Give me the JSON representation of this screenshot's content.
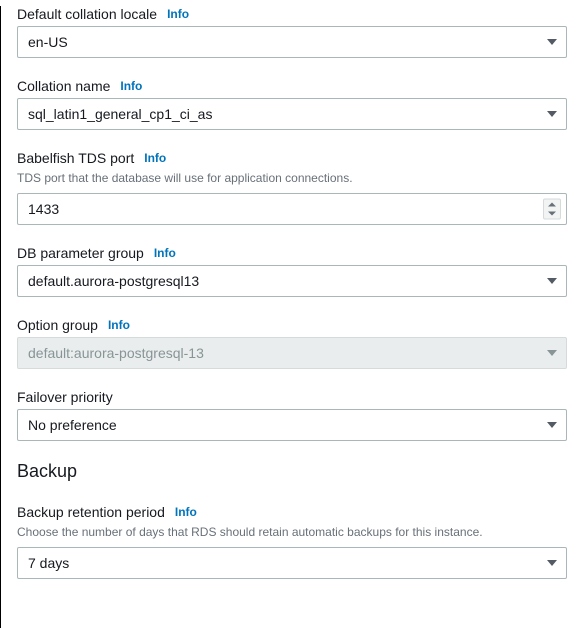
{
  "info_label": "Info",
  "fields": {
    "collation_locale": {
      "label": "Default collation locale",
      "value": "en-US"
    },
    "collation_name": {
      "label": "Collation name",
      "value": "sql_latin1_general_cp1_ci_as"
    },
    "tds_port": {
      "label": "Babelfish TDS port",
      "description": "TDS port that the database will use for application connections.",
      "value": "1433"
    },
    "db_param_group": {
      "label": "DB parameter group",
      "value": "default.aurora-postgresql13"
    },
    "option_group": {
      "label": "Option group",
      "value": "default:aurora-postgresql-13"
    },
    "failover_priority": {
      "label": "Failover priority",
      "value": "No preference"
    },
    "backup_retention": {
      "label": "Backup retention period",
      "description": "Choose the number of days that RDS should retain automatic backups for this instance.",
      "value": "7 days"
    }
  },
  "sections": {
    "backup": "Backup"
  }
}
